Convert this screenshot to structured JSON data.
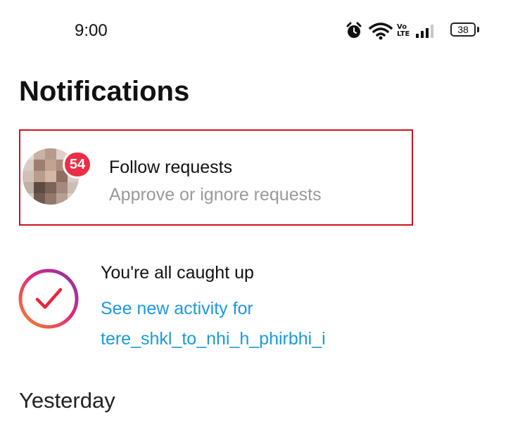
{
  "status_bar": {
    "time": "9:00",
    "icons": [
      "alarm-icon",
      "wifi-icon",
      "volte-icon",
      "signal-icon"
    ],
    "volte_top": "Vo",
    "volte_bottom": "LTE",
    "battery": "38"
  },
  "header": {
    "title": "Notifications"
  },
  "follow_requests": {
    "badge_count": "54",
    "title": "Follow requests",
    "subtitle": "Approve or ignore requests"
  },
  "caught_up": {
    "title": "You're all caught up",
    "link_line1": "See new activity for",
    "link_line2": "tere_shkl_to_nhi_h_phirbhi_i"
  },
  "sections": {
    "yesterday": "Yesterday"
  },
  "colors": {
    "highlight_border": "#d0121b",
    "badge": "#ed2d47",
    "link": "#1a9ae0",
    "ring_gradient": [
      "#f58529",
      "#dd2a7b",
      "#8134af"
    ],
    "check": "#e5283d"
  }
}
